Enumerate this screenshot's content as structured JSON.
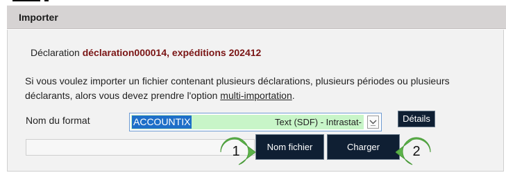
{
  "panel": {
    "title": "Importer"
  },
  "declaration": {
    "label": "Déclaration",
    "value": "déclaration000014, expéditions 202412"
  },
  "info": {
    "text_before_link": "Si vous voulez importer un fichier contenant plusieurs déclarations, plusieurs périodes ou plusieurs déclarants, alors vous devez prendre l'option ",
    "link_label": "multi-importation",
    "text_after_link": "."
  },
  "format": {
    "label": "Nom du format",
    "selected_code": "ACCOUNTIX",
    "selected_description": "Text (SDF) - Intrastat-",
    "details_label": "Détails"
  },
  "actions": {
    "file_button_label": "Nom fichier",
    "load_button_label": "Charger",
    "file_value": ""
  },
  "markers": [
    {
      "number": "1",
      "color": "#5db34a"
    },
    {
      "number": "2",
      "color": "#5db34a"
    }
  ]
}
